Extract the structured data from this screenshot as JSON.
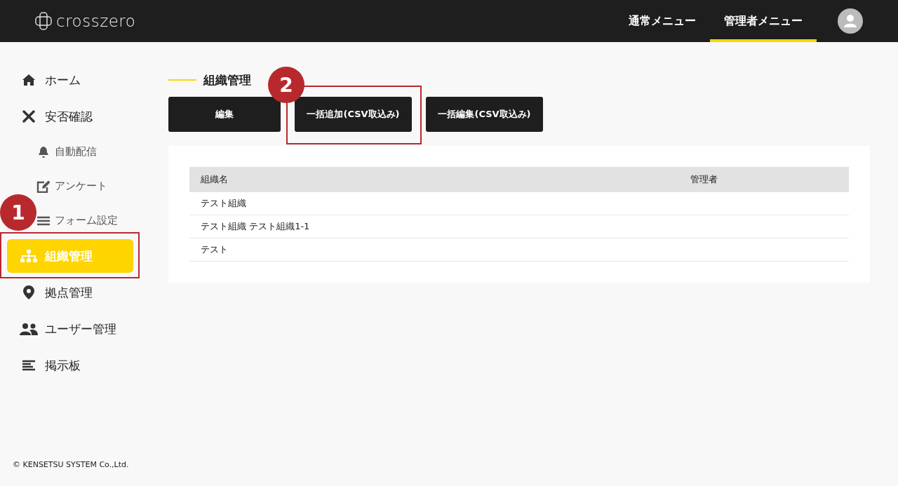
{
  "header": {
    "logo": "crosszero",
    "nav": [
      {
        "label": "通常メニュー",
        "selected": false
      },
      {
        "label": "管理者メニュー",
        "selected": true
      }
    ]
  },
  "sidebar": {
    "items": [
      {
        "label": "ホーム",
        "kind": "main",
        "selected": false
      },
      {
        "label": "安否確認",
        "kind": "main",
        "selected": false
      },
      {
        "label": "自動配信",
        "kind": "sub",
        "selected": false
      },
      {
        "label": "アンケート",
        "kind": "sub",
        "selected": false
      },
      {
        "label": "フォーム設定",
        "kind": "sub",
        "selected": false
      },
      {
        "label": "組織管理",
        "kind": "main",
        "selected": true
      },
      {
        "label": "拠点管理",
        "kind": "main",
        "selected": false
      },
      {
        "label": "ユーザー管理",
        "kind": "main",
        "selected": false
      },
      {
        "label": "掲示板",
        "kind": "main",
        "selected": false
      }
    ]
  },
  "page": {
    "title": "組織管理",
    "buttons": [
      "編集",
      "一括追加(CSV取込み)",
      "一括編集(CSV取込み)"
    ],
    "table": {
      "columns": [
        "組織名",
        "管理者"
      ],
      "rows": [
        [
          "テスト組織",
          ""
        ],
        [
          "テスト組織 テスト組織1-1",
          ""
        ],
        [
          "テスト",
          ""
        ]
      ]
    }
  },
  "footer": "© KENSETSU SYSTEM Co.,Ltd.",
  "callouts": [
    {
      "label": "1"
    },
    {
      "label": "2"
    }
  ]
}
